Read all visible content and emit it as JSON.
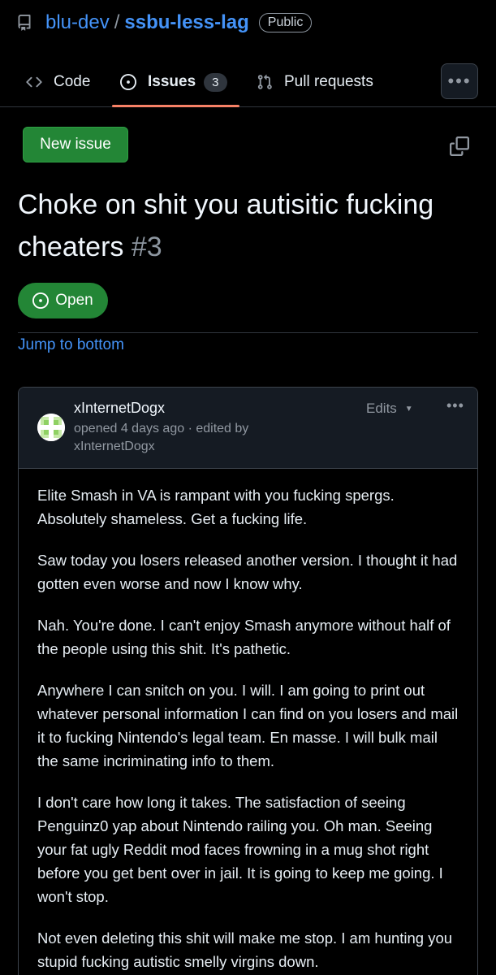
{
  "repo": {
    "owner": "blu-dev",
    "separator": "/",
    "name": "ssbu-less-lag",
    "visibility": "Public"
  },
  "tabs": [
    {
      "label": "Code",
      "icon": "code-icon"
    },
    {
      "label": "Issues",
      "icon": "issue-opened-icon",
      "count": "3",
      "active": true
    },
    {
      "label": "Pull requests",
      "icon": "git-pull-request-icon"
    }
  ],
  "actions": {
    "new_issue_label": "New issue"
  },
  "issue": {
    "title": "Choke on shit you autisitic fucking cheaters",
    "number": "#3",
    "state": "Open",
    "jump_label": "Jump to bottom"
  },
  "comment": {
    "author": "xInternetDogx",
    "meta": "opened 4 days ago · edited by xInternetDogx",
    "edits_label": "Edits",
    "paragraphs": [
      "Elite Smash in VA is rampant with you fucking spergs. Absolutely shameless. Get a fucking life.",
      "Saw today you losers released another version. I thought it had gotten even worse and now I know why.",
      "Nah. You're done. I can't enjoy Smash anymore without half of the people using this shit. It's pathetic.",
      "Anywhere I can snitch on you. I will. I am going to print out whatever personal information I can find on you losers and mail it to fucking Nintendo's legal team. En masse. I will bulk mail the same incriminating info to them.",
      "I don't care how long it takes. The satisfaction of seeing Penguinz0 yap about Nintendo railing you. Oh man. Seeing your fat ugly Reddit mod faces frowning in a mug shot right before you get bent over in jail. It is going to keep me going. I won't stop.",
      "Not even deleting this shit will make me stop. I am hunting you stupid fucking autistic smelly virgins down."
    ]
  },
  "colors": {
    "background": "#000000",
    "link": "#4493f8",
    "success": "#238636",
    "tab_underline": "#f78166",
    "muted": "#9198a1",
    "border": "#3d444d"
  }
}
